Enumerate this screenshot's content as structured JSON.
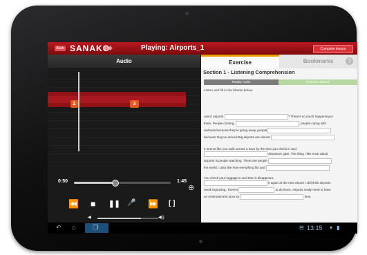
{
  "topbar": {
    "back_label": "Back",
    "logo": "SANAKO",
    "logo_mark": "◆◆",
    "title": "Playing: Airports_1",
    "complete_label": "Complete lesson"
  },
  "audio_panel": {
    "header": "Audio",
    "markers": [
      "2",
      "3"
    ],
    "current_time": "0:50",
    "total_time": "1:45",
    "progress_fraction": 0.42,
    "volume_fraction": 0.72,
    "icons": {
      "rewind": "⏪",
      "stop": "■",
      "pause": "❚❚",
      "record": "🎤",
      "forward": "⏩",
      "fullscreen": "[ ]",
      "zoom": "⊕",
      "volume_low": "◀",
      "volume_high": "◀))"
    }
  },
  "exercise_panel": {
    "tabs": [
      "Exercise",
      "Bookmarks"
    ],
    "active_tab": "Exercise",
    "help_icon": "?",
    "section_title": "Section 1 - Listening Comprehension",
    "replay_label": "Replay Audio",
    "started_label": "Exercise Started",
    "instructions": "Listen and fill in the blanks below.",
    "lines": [
      {
        "pre": "Aren't airports",
        "post": "? There's so much happening in"
      },
      {
        "pre": "them. People coming,",
        "post": ", people crying with"
      },
      {
        "pre": "sadness because they're going away, people",
        "post": ""
      },
      {
        "pre": "because they've arrived.Big airports are almost",
        "post": ""
      },
      {
        "pre": "It seems like you walk across a town by the time you check in and",
        "post": ""
      },
      {
        "pre": "",
        "post": "departure gate. The thing I like most about"
      },
      {
        "pre": "airports is people watching. There are people",
        "post": ""
      },
      {
        "pre": "the world. I also like how everything fits and",
        "post": ""
      },
      {
        "pre": "You check your luggage in and then it disappears,",
        "post": ""
      },
      {
        "pre": "",
        "post": "it again at the next airport I still think airports"
      },
      {
        "pre": "need improving. There's",
        "post": "to do there. Airports really need to have"
      },
      {
        "pre": "an entertainment area so",
        "post": "time."
      }
    ]
  },
  "navbar": {
    "back_icon": "↶",
    "home_icon": "⌂",
    "recents_icon": "❐",
    "clock": "13:15",
    "status_icons": [
      "⊟",
      "▾",
      "▮"
    ]
  }
}
